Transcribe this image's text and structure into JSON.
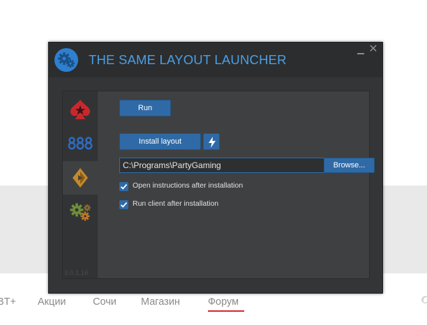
{
  "website": {
    "nav": [
      {
        "label": "BT+"
      },
      {
        "label": "Акции"
      },
      {
        "label": "Сочи"
      },
      {
        "label": "Магазин"
      },
      {
        "label": "Форум",
        "active": true
      }
    ],
    "accent_color": "#d6262e"
  },
  "launcher": {
    "title": "THE SAME LAYOUT LAUNCHER",
    "title_color": "#4a9fe6",
    "sidebar": [
      {
        "icon": "pokerstars-icon"
      },
      {
        "icon": "888-icon"
      },
      {
        "icon": "partypoker-icon",
        "active": true
      },
      {
        "icon": "settings-gears-icon"
      }
    ],
    "version": "3.0.1.16",
    "buttons": {
      "run": "Run",
      "install": "Install layout",
      "browse": "Browse..."
    },
    "install_path": "C:\\Programs\\PartyGaming",
    "options": [
      {
        "label": "Open instructions after installation",
        "checked": true
      },
      {
        "label": "Run client after installation",
        "checked": true
      }
    ]
  }
}
